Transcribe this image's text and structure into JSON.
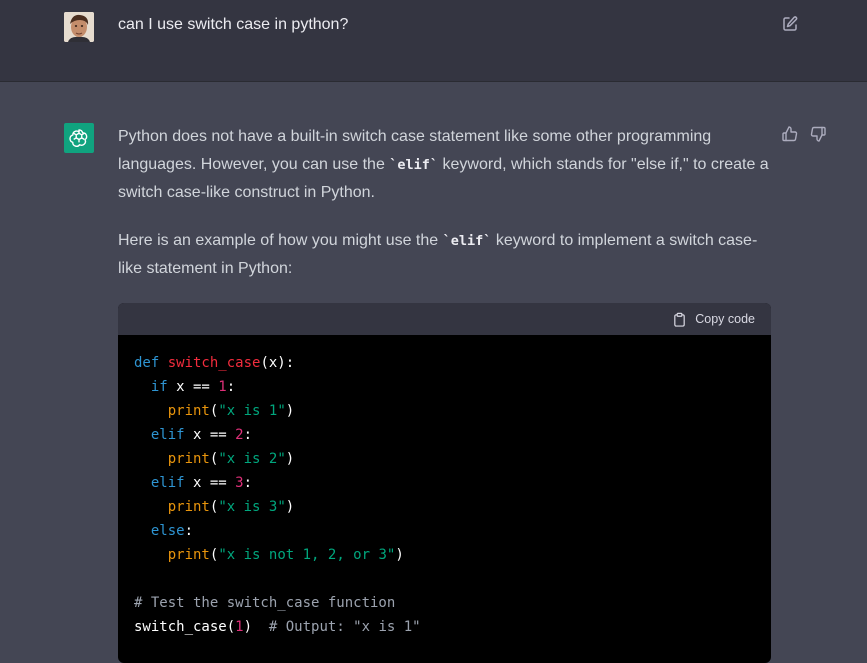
{
  "user_message": {
    "text": "can I use switch case in python?"
  },
  "assistant_message": {
    "paragraph1_before": "Python does not have a built-in switch case statement like some other programming languages. However, you can use the ",
    "paragraph1_code": "`elif`",
    "paragraph1_after": " keyword, which stands for \"else if,\" to create a switch case-like construct in Python.",
    "paragraph2_before": "Here is an example of how you might use the ",
    "paragraph2_code": "`elif`",
    "paragraph2_after": " keyword to implement a switch case-like statement in Python:"
  },
  "code_block": {
    "copy_label": "Copy code",
    "lines": [
      [
        {
          "t": "def ",
          "c": "kw"
        },
        {
          "t": "switch_case",
          "c": "fn"
        },
        {
          "t": "(x):",
          "c": "pl"
        }
      ],
      [
        {
          "t": "  ",
          "c": "pl"
        },
        {
          "t": "if",
          "c": "kw"
        },
        {
          "t": " x == ",
          "c": "pl"
        },
        {
          "t": "1",
          "c": "num"
        },
        {
          "t": ":",
          "c": "pl"
        }
      ],
      [
        {
          "t": "    ",
          "c": "pl"
        },
        {
          "t": "print",
          "c": "bi"
        },
        {
          "t": "(",
          "c": "pl"
        },
        {
          "t": "\"x is 1\"",
          "c": "str"
        },
        {
          "t": ")",
          "c": "pl"
        }
      ],
      [
        {
          "t": "  ",
          "c": "pl"
        },
        {
          "t": "elif",
          "c": "kw"
        },
        {
          "t": " x == ",
          "c": "pl"
        },
        {
          "t": "2",
          "c": "num"
        },
        {
          "t": ":",
          "c": "pl"
        }
      ],
      [
        {
          "t": "    ",
          "c": "pl"
        },
        {
          "t": "print",
          "c": "bi"
        },
        {
          "t": "(",
          "c": "pl"
        },
        {
          "t": "\"x is 2\"",
          "c": "str"
        },
        {
          "t": ")",
          "c": "pl"
        }
      ],
      [
        {
          "t": "  ",
          "c": "pl"
        },
        {
          "t": "elif",
          "c": "kw"
        },
        {
          "t": " x == ",
          "c": "pl"
        },
        {
          "t": "3",
          "c": "num"
        },
        {
          "t": ":",
          "c": "pl"
        }
      ],
      [
        {
          "t": "    ",
          "c": "pl"
        },
        {
          "t": "print",
          "c": "bi"
        },
        {
          "t": "(",
          "c": "pl"
        },
        {
          "t": "\"x is 3\"",
          "c": "str"
        },
        {
          "t": ")",
          "c": "pl"
        }
      ],
      [
        {
          "t": "  ",
          "c": "pl"
        },
        {
          "t": "else",
          "c": "kw"
        },
        {
          "t": ":",
          "c": "pl"
        }
      ],
      [
        {
          "t": "    ",
          "c": "pl"
        },
        {
          "t": "print",
          "c": "bi"
        },
        {
          "t": "(",
          "c": "pl"
        },
        {
          "t": "\"x is not 1, 2, or 3\"",
          "c": "str"
        },
        {
          "t": ")",
          "c": "pl"
        }
      ],
      [],
      [
        {
          "t": "# Test the switch_case function",
          "c": "cm"
        }
      ],
      [
        {
          "t": "switch_case",
          "c": "pl"
        },
        {
          "t": "(",
          "c": "pl"
        },
        {
          "t": "1",
          "c": "num"
        },
        {
          "t": ")  ",
          "c": "pl"
        },
        {
          "t": "# Output: \"x is 1\"",
          "c": "cm"
        }
      ]
    ]
  },
  "icons": {
    "edit": "edit-icon",
    "thumb_up": "thumbs-up-icon",
    "thumb_down": "thumbs-down-icon",
    "copy": "clipboard-icon",
    "assistant_logo": "openai-logo-icon",
    "user_avatar": "user-avatar"
  },
  "colors": {
    "user_bg": "#343541",
    "assistant_bg": "#444654",
    "accent": "#10a37f",
    "code_bg": "#000000",
    "code_header_bg": "#343541"
  }
}
